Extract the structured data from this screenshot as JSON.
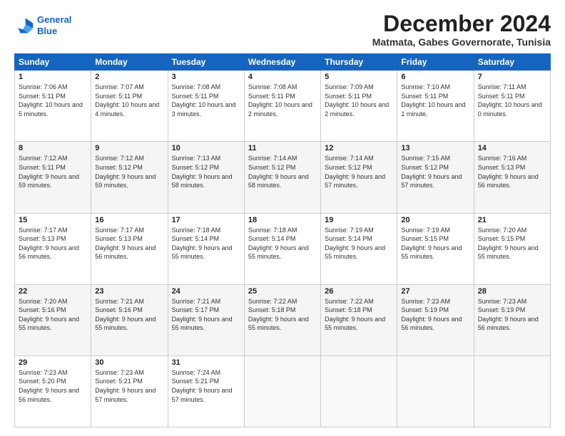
{
  "header": {
    "logo_line1": "General",
    "logo_line2": "Blue",
    "title": "December 2024",
    "subtitle": "Matmata, Gabes Governorate, Tunisia"
  },
  "days_of_week": [
    "Sunday",
    "Monday",
    "Tuesday",
    "Wednesday",
    "Thursday",
    "Friday",
    "Saturday"
  ],
  "weeks": [
    [
      {
        "day": "1",
        "sunrise": "7:06 AM",
        "sunset": "5:11 PM",
        "daylight": "10 hours and 5 minutes."
      },
      {
        "day": "2",
        "sunrise": "7:07 AM",
        "sunset": "5:11 PM",
        "daylight": "10 hours and 4 minutes."
      },
      {
        "day": "3",
        "sunrise": "7:08 AM",
        "sunset": "5:11 PM",
        "daylight": "10 hours and 3 minutes."
      },
      {
        "day": "4",
        "sunrise": "7:08 AM",
        "sunset": "5:11 PM",
        "daylight": "10 hours and 2 minutes."
      },
      {
        "day": "5",
        "sunrise": "7:09 AM",
        "sunset": "5:11 PM",
        "daylight": "10 hours and 2 minutes."
      },
      {
        "day": "6",
        "sunrise": "7:10 AM",
        "sunset": "5:11 PM",
        "daylight": "10 hours and 1 minute."
      },
      {
        "day": "7",
        "sunrise": "7:11 AM",
        "sunset": "5:11 PM",
        "daylight": "10 hours and 0 minutes."
      }
    ],
    [
      {
        "day": "8",
        "sunrise": "7:12 AM",
        "sunset": "5:11 PM",
        "daylight": "9 hours and 59 minutes."
      },
      {
        "day": "9",
        "sunrise": "7:12 AM",
        "sunset": "5:12 PM",
        "daylight": "9 hours and 59 minutes."
      },
      {
        "day": "10",
        "sunrise": "7:13 AM",
        "sunset": "5:12 PM",
        "daylight": "9 hours and 58 minutes."
      },
      {
        "day": "11",
        "sunrise": "7:14 AM",
        "sunset": "5:12 PM",
        "daylight": "9 hours and 58 minutes."
      },
      {
        "day": "12",
        "sunrise": "7:14 AM",
        "sunset": "5:12 PM",
        "daylight": "9 hours and 57 minutes."
      },
      {
        "day": "13",
        "sunrise": "7:15 AM",
        "sunset": "5:12 PM",
        "daylight": "9 hours and 57 minutes."
      },
      {
        "day": "14",
        "sunrise": "7:16 AM",
        "sunset": "5:13 PM",
        "daylight": "9 hours and 56 minutes."
      }
    ],
    [
      {
        "day": "15",
        "sunrise": "7:17 AM",
        "sunset": "5:13 PM",
        "daylight": "9 hours and 56 minutes."
      },
      {
        "day": "16",
        "sunrise": "7:17 AM",
        "sunset": "5:13 PM",
        "daylight": "9 hours and 56 minutes."
      },
      {
        "day": "17",
        "sunrise": "7:18 AM",
        "sunset": "5:14 PM",
        "daylight": "9 hours and 55 minutes."
      },
      {
        "day": "18",
        "sunrise": "7:18 AM",
        "sunset": "5:14 PM",
        "daylight": "9 hours and 55 minutes."
      },
      {
        "day": "19",
        "sunrise": "7:19 AM",
        "sunset": "5:14 PM",
        "daylight": "9 hours and 55 minutes."
      },
      {
        "day": "20",
        "sunrise": "7:19 AM",
        "sunset": "5:15 PM",
        "daylight": "9 hours and 55 minutes."
      },
      {
        "day": "21",
        "sunrise": "7:20 AM",
        "sunset": "5:15 PM",
        "daylight": "9 hours and 55 minutes."
      }
    ],
    [
      {
        "day": "22",
        "sunrise": "7:20 AM",
        "sunset": "5:16 PM",
        "daylight": "9 hours and 55 minutes."
      },
      {
        "day": "23",
        "sunrise": "7:21 AM",
        "sunset": "5:16 PM",
        "daylight": "9 hours and 55 minutes."
      },
      {
        "day": "24",
        "sunrise": "7:21 AM",
        "sunset": "5:17 PM",
        "daylight": "9 hours and 55 minutes."
      },
      {
        "day": "25",
        "sunrise": "7:22 AM",
        "sunset": "5:18 PM",
        "daylight": "9 hours and 55 minutes."
      },
      {
        "day": "26",
        "sunrise": "7:22 AM",
        "sunset": "5:18 PM",
        "daylight": "9 hours and 55 minutes."
      },
      {
        "day": "27",
        "sunrise": "7:23 AM",
        "sunset": "5:19 PM",
        "daylight": "9 hours and 56 minutes."
      },
      {
        "day": "28",
        "sunrise": "7:23 AM",
        "sunset": "5:19 PM",
        "daylight": "9 hours and 56 minutes."
      }
    ],
    [
      {
        "day": "29",
        "sunrise": "7:23 AM",
        "sunset": "5:20 PM",
        "daylight": "9 hours and 56 minutes."
      },
      {
        "day": "30",
        "sunrise": "7:23 AM",
        "sunset": "5:21 PM",
        "daylight": "9 hours and 57 minutes."
      },
      {
        "day": "31",
        "sunrise": "7:24 AM",
        "sunset": "5:21 PM",
        "daylight": "9 hours and 57 minutes."
      },
      null,
      null,
      null,
      null
    ]
  ]
}
